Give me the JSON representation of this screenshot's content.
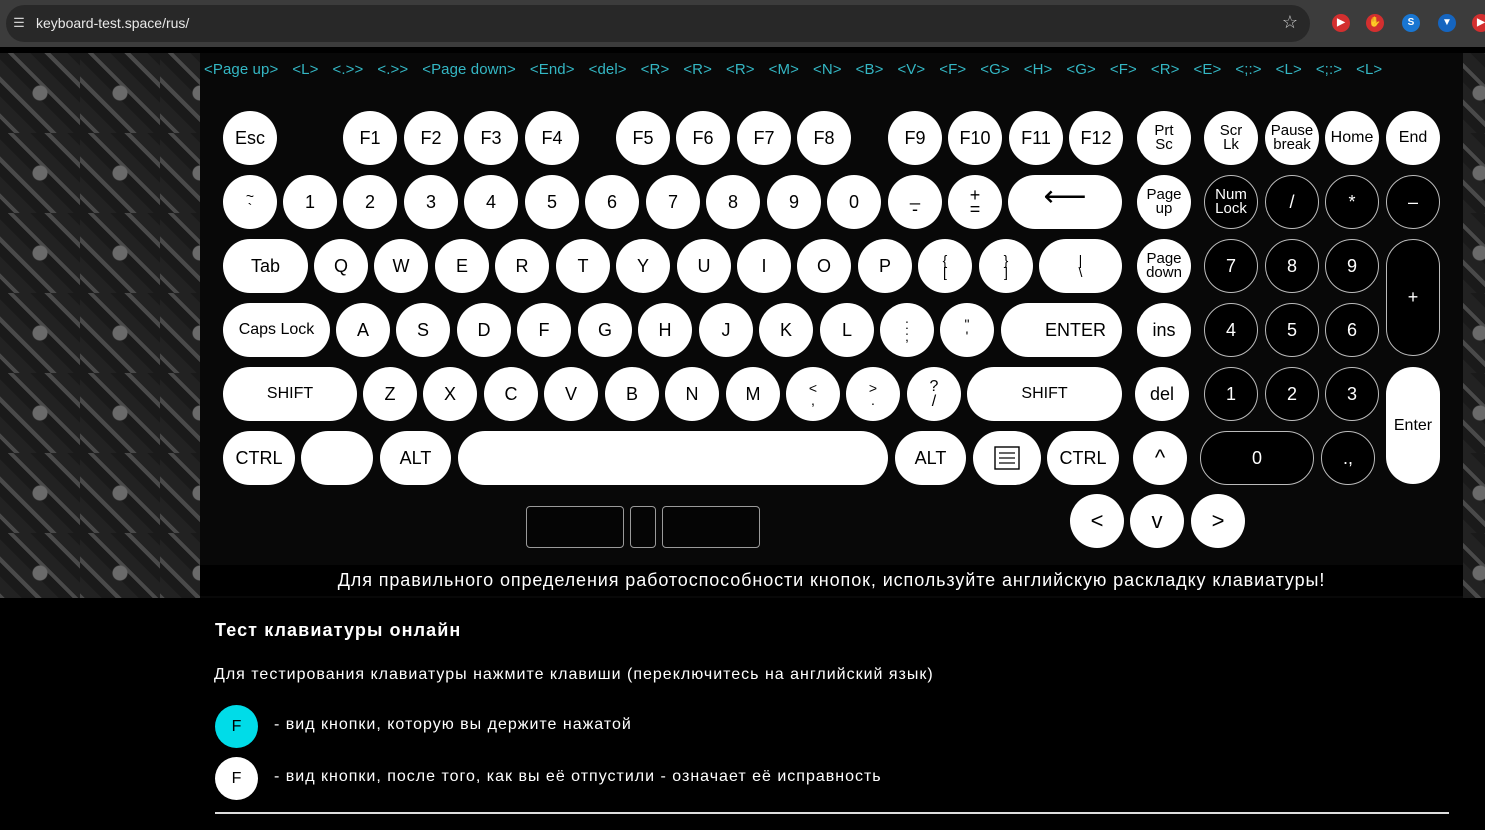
{
  "browser": {
    "url": "keyboard-test.space/rus/",
    "extensions": [
      {
        "icon": "video-extension-icon",
        "color": "#d32f2f",
        "glyph": "▶"
      },
      {
        "icon": "hand-extension-icon",
        "color": "#d32f2f",
        "glyph": "✋"
      },
      {
        "icon": "shazam-extension-icon",
        "color": "#1976d2",
        "glyph": "S"
      },
      {
        "icon": "shield-extension-icon",
        "color": "#1565c0",
        "glyph": "▼"
      },
      {
        "icon": "youtube-extension-icon",
        "color": "#d32f2f",
        "glyph": "▶"
      }
    ]
  },
  "key_log": [
    "<Page up>",
    "<L>",
    "<.>>",
    "<.>>",
    "<Page down>",
    "<End>",
    "<del>",
    "<R>",
    "<R>",
    "<R>",
    "<M>",
    "<N>",
    "<B>",
    "<V>",
    "<F>",
    "<G>",
    "<H>",
    "<G>",
    "<F>",
    "<R>",
    "<E>",
    "<;:>",
    "<L>",
    "<;:>",
    "<L>"
  ],
  "keys": {
    "esc": "Esc",
    "f1": "F1",
    "f2": "F2",
    "f3": "F3",
    "f4": "F4",
    "f5": "F5",
    "f6": "F6",
    "f7": "F7",
    "f8": "F8",
    "f9": "F9",
    "f10": "F10",
    "f11": "F11",
    "f12": "F12",
    "prtsc_1": "Prt",
    "prtsc_2": "Sc",
    "scrlk_1": "Scr",
    "scrlk_2": "Lk",
    "pause_1": "Pause",
    "pause_2": "break",
    "home": "Home",
    "end": "End",
    "tilde_top": "~",
    "tilde_bottom": "`",
    "d1": "1",
    "d2": "2",
    "d3": "3",
    "d4": "4",
    "d5": "5",
    "d6": "6",
    "d7": "7",
    "d8": "8",
    "d9": "9",
    "d0": "0",
    "minus_top": "_",
    "minus_bottom": "-",
    "equal_top": "+",
    "equal_bottom": "=",
    "backspace": "⟵",
    "pgup_1": "Page",
    "pgup_2": "up",
    "numlock_1": "Num",
    "numlock_2": "Lock",
    "np_div": "/",
    "np_mul": "*",
    "np_sub": "–",
    "tab": "Tab",
    "q": "Q",
    "w": "W",
    "e": "E",
    "r": "R",
    "t": "T",
    "y": "Y",
    "u": "U",
    "i": "I",
    "o": "O",
    "p": "P",
    "lbracket_top": "{",
    "lbracket_bottom": "[",
    "rbracket_top": "}",
    "rbracket_bottom": "]",
    "backslash_top": "|",
    "backslash_bottom": "\\",
    "pgdn_1": "Page",
    "pgdn_2": "down",
    "np7": "7",
    "np8": "8",
    "np9": "9",
    "np_add": "+",
    "capslock": "Caps Lock",
    "a": "A",
    "s": "S",
    "d": "D",
    "f": "F",
    "g": "G",
    "h": "H",
    "j": "J",
    "k": "K",
    "l": "L",
    "semicolon_top": ":",
    "semicolon_bottom": ";",
    "quote_top": "\"",
    "quote_bottom": "'",
    "enter": "ENTER",
    "ins": "ins",
    "np4": "4",
    "np5": "5",
    "np6": "6",
    "lshift": "SHIFT",
    "z": "Z",
    "x": "X",
    "c": "C",
    "v": "V",
    "b": "B",
    "n": "N",
    "m": "M",
    "comma_top": "<",
    "comma_bottom": ",",
    "period_top": ">",
    "period_bottom": ".",
    "slash_top": "?",
    "slash_bottom": "/",
    "rshift": "SHIFT",
    "del": "del",
    "np1": "1",
    "np2": "2",
    "np3": "3",
    "np_enter": "Enter",
    "lctrl": "CTRL",
    "lalt": "ALT",
    "ralt": "ALT",
    "rctrl": "CTRL",
    "up": "^",
    "np0": "0",
    "np_dot": ".,",
    "left": "<",
    "down": "v",
    "right": ">"
  },
  "notice": "Для правильного определения работоспособности кнопок, используйте английскую раскладку клавиатуры!",
  "content": {
    "heading": "Тест клавиатуры онлайн",
    "description": "Для тестирования клавиатуры нажмите клавиши (переключитесь на английский язык)",
    "legend_pressed_key": "F",
    "legend_pressed_text": "- вид кнопки, которую вы держите нажатой",
    "legend_released_key": "F",
    "legend_released_text": "- вид кнопки, после того, как вы её отпустили - означает её исправность",
    "pressed_color": "#00dce8",
    "released_color": "#ffffff"
  }
}
